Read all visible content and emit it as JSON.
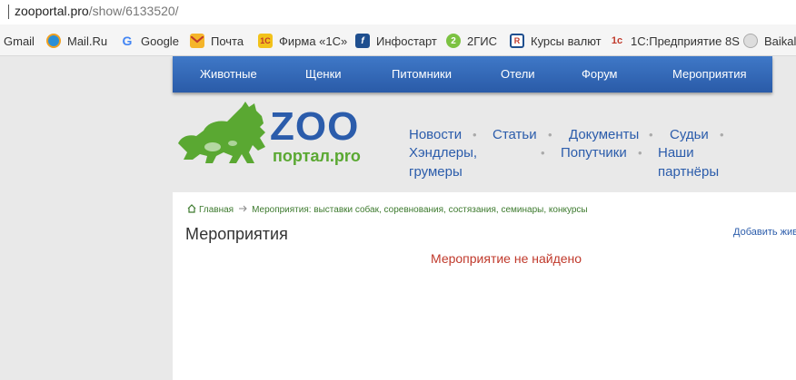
{
  "browser": {
    "url_host": "zooportal.pro",
    "url_path": "/show/6133520/"
  },
  "bookmarks": [
    {
      "label": "Gmail",
      "icon": "gmail-icon"
    },
    {
      "label": "Mail.Ru",
      "icon": "mailru-icon"
    },
    {
      "label": "Google",
      "icon": "google-icon"
    },
    {
      "label": "Почта",
      "icon": "mail-envelope-icon"
    },
    {
      "label": "Фирма «1С»",
      "icon": "1c-firm-icon"
    },
    {
      "label": "Инфостарт",
      "icon": "infostart-icon"
    },
    {
      "label": "2ГИС",
      "icon": "2gis-icon"
    },
    {
      "label": "Курсы валют",
      "icon": "currency-icon"
    },
    {
      "label": "1С:Предприятие 8S",
      "icon": "1c-enterprise-icon"
    },
    {
      "label": "Baikals",
      "icon": "baikals-icon"
    }
  ],
  "nav": {
    "items": [
      "Животные",
      "Щенки",
      "Питомники",
      "Отели",
      "Форум",
      "Мероприятия"
    ]
  },
  "logo": {
    "main": "ZOO",
    "sub": "портал.pro"
  },
  "links": {
    "row1": [
      "Новости",
      "Статьи",
      "Документы",
      "Судьи"
    ],
    "row2": [
      "Хэндлеры, грумеры",
      "Попутчики",
      "Наши партнёры"
    ],
    "separator": "•"
  },
  "breadcrumb": {
    "home": "Главная",
    "current": "Мероприятия: выставки собак, соревнования, состязания, семинары, конкурсы"
  },
  "page": {
    "title": "Мероприятия",
    "add_link": "Добавить жив",
    "message": "Мероприятие не найдено"
  },
  "colors": {
    "nav_blue": "#2f63b0",
    "logo_green": "#5aa832",
    "logo_blue": "#2b5cab",
    "error_red": "#c0392b"
  }
}
